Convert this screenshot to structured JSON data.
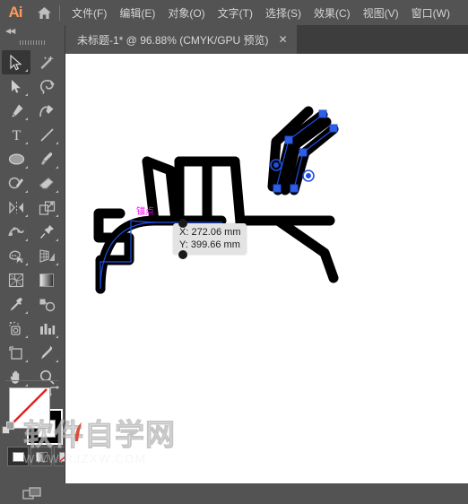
{
  "app": {
    "logo_text": "Ai",
    "home_icon": "home-icon"
  },
  "menubar": {
    "items": [
      {
        "label": "文件(F)"
      },
      {
        "label": "编辑(E)"
      },
      {
        "label": "对象(O)"
      },
      {
        "label": "文字(T)"
      },
      {
        "label": "选择(S)"
      },
      {
        "label": "效果(C)"
      },
      {
        "label": "视图(V)"
      },
      {
        "label": "窗口(W)"
      }
    ]
  },
  "tabbar": {
    "document_title": "未标题-1* @ 96.88% (CMYK/GPU 预览)",
    "close_label": "✕"
  },
  "toolbar": {
    "collapse_label": "◀◀",
    "tools": [
      {
        "name": "selection-tool",
        "icon": "arrow-solid-outline",
        "active": true
      },
      {
        "name": "magic-wand-tool",
        "icon": "magic-wand",
        "active": false
      },
      {
        "name": "direct-selection-tool",
        "icon": "arrow-filled",
        "active": false
      },
      {
        "name": "lasso-tool",
        "icon": "lasso",
        "active": false
      },
      {
        "name": "pen-tool",
        "icon": "pen",
        "active": false
      },
      {
        "name": "curvature-tool",
        "icon": "curvature-pen",
        "active": false
      },
      {
        "name": "type-tool",
        "icon": "type-T",
        "active": false
      },
      {
        "name": "line-segment-tool",
        "icon": "line-diagonal",
        "active": false
      },
      {
        "name": "ellipse-tool",
        "icon": "ellipse",
        "active": false
      },
      {
        "name": "paintbrush-tool",
        "icon": "paintbrush",
        "active": false
      },
      {
        "name": "shaper-tool",
        "icon": "shaper-pencil",
        "active": false
      },
      {
        "name": "eraser-tool",
        "icon": "eraser",
        "active": false
      },
      {
        "name": "rotate-tool",
        "icon": "reflect",
        "active": false
      },
      {
        "name": "scale-tool",
        "icon": "scale-box",
        "active": false
      },
      {
        "name": "width-tool",
        "icon": "width-warp",
        "active": false
      },
      {
        "name": "free-transform-tool",
        "icon": "pushpin",
        "active": false
      },
      {
        "name": "shape-builder-tool",
        "icon": "shape-builder",
        "active": false
      },
      {
        "name": "perspective-grid-tool",
        "icon": "perspective-grid",
        "active": false
      },
      {
        "name": "mesh-tool",
        "icon": "mesh",
        "active": false
      },
      {
        "name": "gradient-tool",
        "icon": "gradient-bar",
        "active": false
      },
      {
        "name": "eyedropper-tool",
        "icon": "eyedropper",
        "active": false
      },
      {
        "name": "blend-tool",
        "icon": "blend",
        "active": false
      },
      {
        "name": "symbol-sprayer-tool",
        "icon": "symbol-sprayer",
        "active": false
      },
      {
        "name": "column-graph-tool",
        "icon": "bar-chart",
        "active": false
      },
      {
        "name": "artboard-tool",
        "icon": "artboard",
        "active": false
      },
      {
        "name": "slice-tool",
        "icon": "slice-knife",
        "active": false
      },
      {
        "name": "hand-tool",
        "icon": "hand",
        "active": false
      },
      {
        "name": "zoom-tool",
        "icon": "magnifier",
        "active": false
      }
    ],
    "fill": {
      "name": "fill-swatch",
      "value": "none",
      "color": "#ffffff",
      "slash_color": "#e02020"
    },
    "stroke": {
      "name": "stroke-swatch",
      "color": "#000000"
    },
    "swap_icon": "swap-fill-stroke-icon",
    "default_icon": "default-fill-stroke-icon",
    "color_modes": [
      {
        "name": "color-mode-color",
        "icon": "color-swatch-icon",
        "selected": true
      },
      {
        "name": "color-mode-gradient",
        "icon": "gradient-swatch-icon",
        "selected": false
      },
      {
        "name": "color-mode-none",
        "icon": "none-swatch-icon",
        "selected": false
      }
    ],
    "screen_mode": {
      "name": "screen-mode-button",
      "icon": "screen-mode-icon"
    }
  },
  "canvas": {
    "smart_guide_label": "锚点",
    "smart_guide_color": "#ff00ff",
    "tooltip": {
      "x_line": "X: 272.06 mm",
      "y_line": "Y: 399.66 mm"
    },
    "selection_color": "#1f4fe0",
    "artwork_color": "#000000"
  },
  "watermark": {
    "big_text": "软件自学网",
    "small_text": "WWW.RJZXW.COM"
  }
}
